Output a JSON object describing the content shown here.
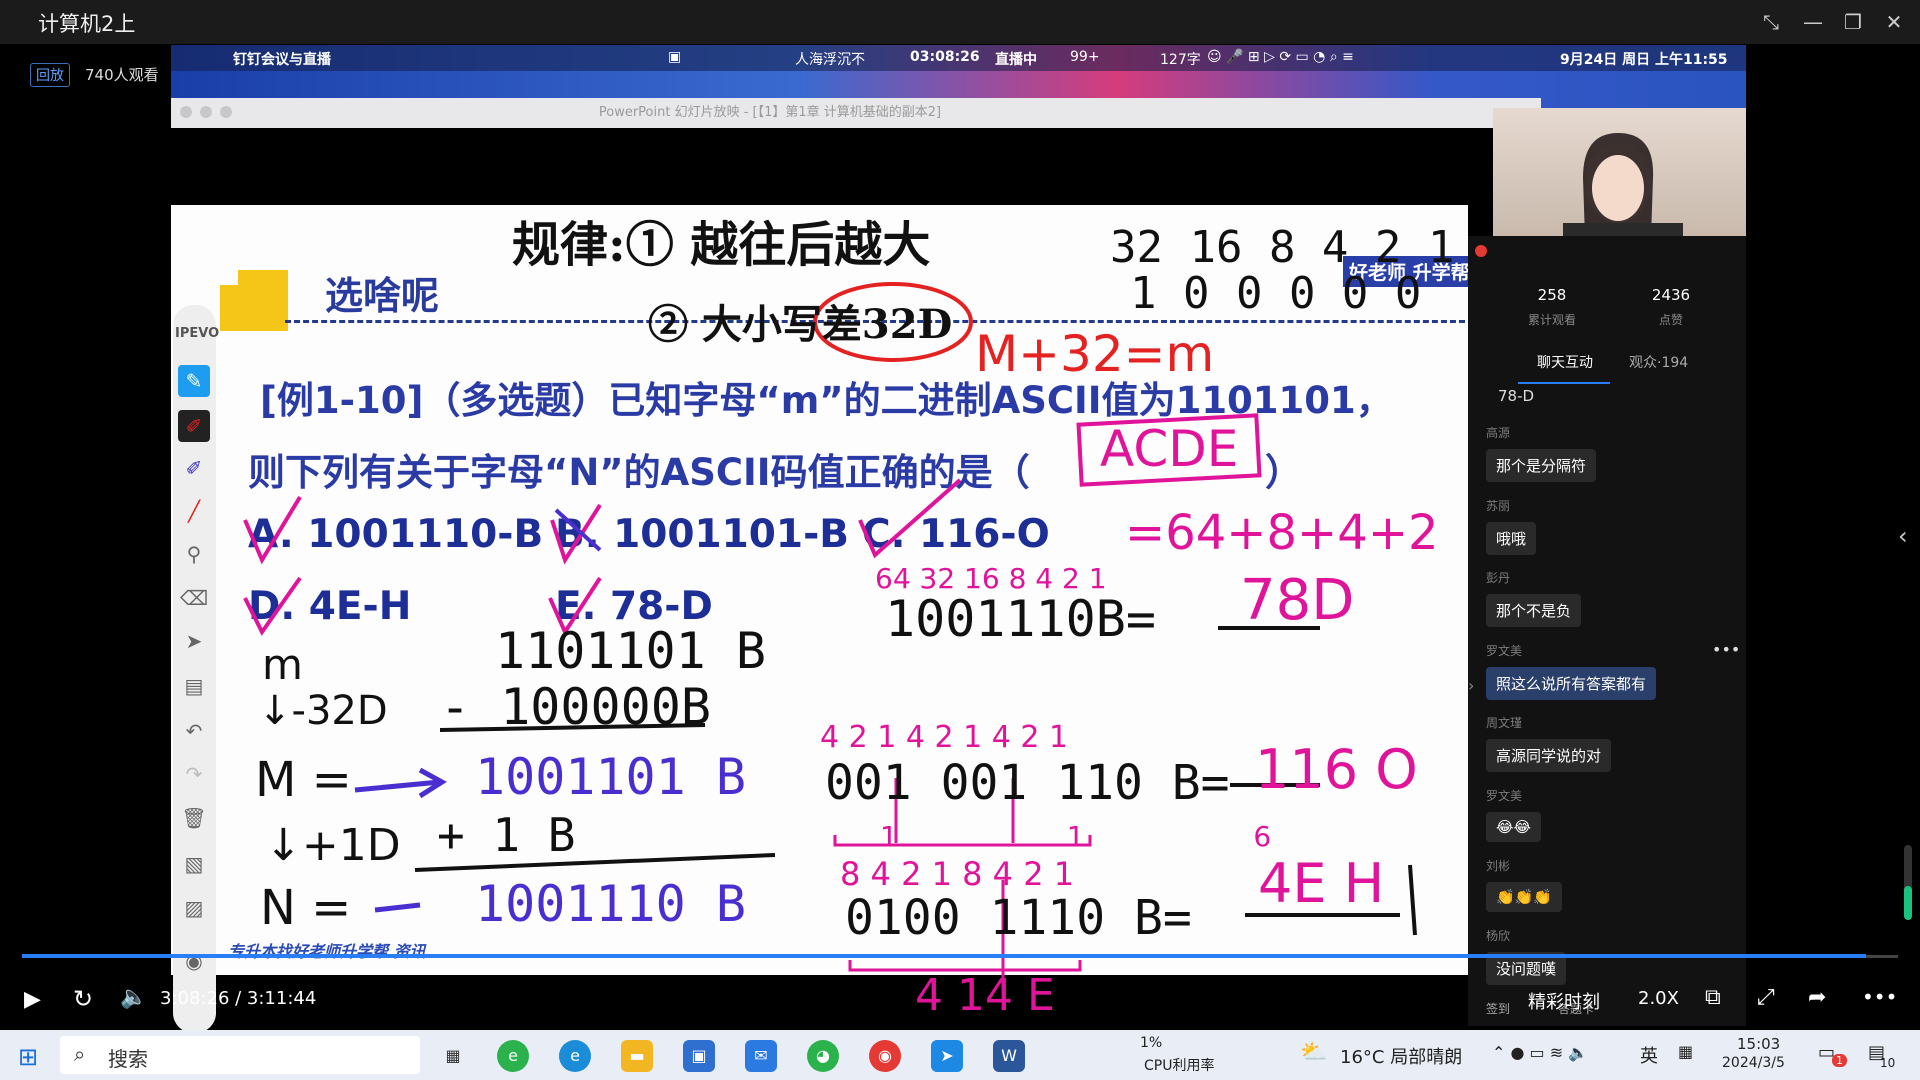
{
  "window": {
    "title": "计算机2上",
    "controls": [
      "expand-icon",
      "minimize-icon",
      "restore-icon",
      "close-icon"
    ]
  },
  "live": {
    "replay_badge": "回放",
    "viewers": "740人观看"
  },
  "mac_menubar": {
    "app_name": "钉钉会议与直播",
    "presenter": "人海浮沉不",
    "timer": "03:08:26",
    "live_status": "直播中",
    "badge_count": "99+",
    "word_count": "127字",
    "datetime": "9月24日 周日 上午11:55"
  },
  "ppt": {
    "title": "PowerPoint 幻灯片放映 - [【1】第1章 计算机基础的副本2]"
  },
  "slide": {
    "heading": "选啥呢",
    "question_line1": "[例1-10]（多选题）已知字母“m”的二进制ASCII值为1101101，",
    "question_line2": "则下列有关于字母“N”的ASCII码值正确的是（",
    "question_line2_end": "）",
    "options": {
      "a": "A. 1001110-B",
      "b": "B. 1001101-B",
      "c": "C. 116-O",
      "d": "D. 4E-H",
      "e": "E. 78-D"
    },
    "footer": "专升本找好老师升学帮 资讯",
    "brand_badge": "好老师 升学帮"
  },
  "annotations": {
    "rule_title": "规律:① 越往后越大",
    "rule_2": "② 大小写差32D",
    "weights_row": "32 16 8 4 2 1",
    "weights_bin": "1 0 0 0 0 0",
    "formula": "M+32=m",
    "answer": "ACDE",
    "sum_expr": "=64+8+4+2",
    "weights_a": "64 32 16 8 4 2 1",
    "bin_a": "1001110B=",
    "val_a": "78D",
    "m_label": "m",
    "m_bin": "1101101 B",
    "minus_label": "↓-32D",
    "minus_bin": "- 100000B",
    "cap_m": "M =",
    "cap_m_bin": "1001101 B",
    "plus_label": "↓+1D",
    "plus_bin": "+ 1 B",
    "cap_n": "N =",
    "cap_n_bin": "1001110 B",
    "oct_weights": "4 2 1 4 2 1 4 2 1",
    "oct_bin": "001 001 110 B=",
    "oct_digits": "1 1 6",
    "oct_val": "116 O",
    "hex_weights": "8 4 2 1 8 4 2 1",
    "hex_bin": "0100 1110 B=",
    "hex_digits": "4 14 E",
    "hex_val": "4E H"
  },
  "chat": {
    "stats": [
      {
        "value": "258",
        "label": "累计观看"
      },
      {
        "value": "2436",
        "label": "点赞"
      }
    ],
    "tabs": [
      "聊天互动",
      "观众·194"
    ],
    "partial_msg": "78-D",
    "messages": [
      {
        "name": "高源",
        "text": "那个是分隔符"
      },
      {
        "name": "苏丽",
        "text": "哦哦"
      },
      {
        "name": "彭丹",
        "text": "那个不是负"
      },
      {
        "name": "罗文美",
        "text": "照这么说所有答案都有"
      },
      {
        "name": "周文瑾",
        "text": "高源同学说的对"
      },
      {
        "name": "罗文美",
        "text": "😂😂"
      },
      {
        "name": "刘彬",
        "text": "👏👏👏"
      },
      {
        "name": "杨欣",
        "text": "没问题嘆"
      }
    ],
    "bottom_items": [
      "签到",
      "答题卡"
    ]
  },
  "player": {
    "time": "3:08:26 / 3:11:44",
    "highlight": "精彩时刻",
    "speed": "2.0X",
    "progress": 0.983
  },
  "tool_palette": {
    "label": "IPEVO"
  },
  "taskbar": {
    "search": "搜索",
    "cpu_pct": "1%",
    "cpu_label": "CPU利用率",
    "weather": "16°C 局部晴朗",
    "ime": "英",
    "time": "15:03",
    "date": "2024/3/5",
    "notif_badge": "1",
    "notif_count": "10"
  },
  "colors": {
    "accent": "#2a7ef5",
    "slide_text": "#2b3ba5",
    "ink_pink": "#e0149a",
    "ink_red": "#e52222",
    "ink_purple": "#4a2fd0"
  }
}
